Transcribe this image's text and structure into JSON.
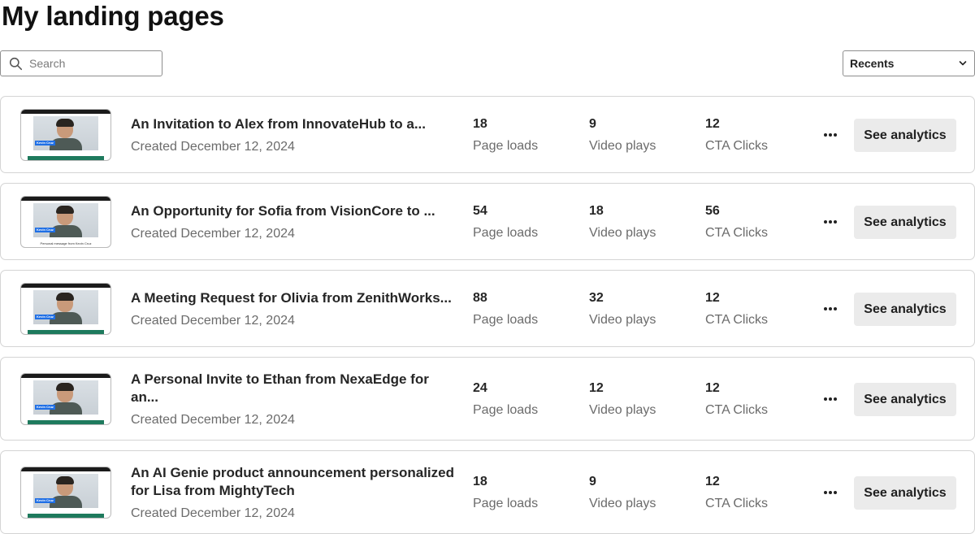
{
  "page": {
    "title": "My landing pages"
  },
  "search": {
    "placeholder": "Search"
  },
  "sort": {
    "selected": "Recents"
  },
  "thumbnail": {
    "person_label": "Kevin Cruz",
    "caption": "Personal message from Kevin Cruz"
  },
  "metric_labels": {
    "page_loads": "Page loads",
    "video_plays": "Video plays",
    "cta_clicks": "CTA Clicks"
  },
  "actions": {
    "see_analytics": "See analytics"
  },
  "landing_pages": [
    {
      "title": "An Invitation to Alex from InnovateHub to a...",
      "created": "Created December 12, 2024",
      "page_loads": "18",
      "video_plays": "9",
      "cta_clicks": "12"
    },
    {
      "title": "An Opportunity for Sofia from VisionCore to ...",
      "created": "Created December 12, 2024",
      "page_loads": "54",
      "video_plays": "18",
      "cta_clicks": "56"
    },
    {
      "title": "A Meeting Request for Olivia from ZenithWorks...",
      "created": "Created December 12, 2024",
      "page_loads": "88",
      "video_plays": "32",
      "cta_clicks": "12"
    },
    {
      "title": "A Personal Invite to Ethan from NexaEdge for an...",
      "created": "Created December 12, 2024",
      "page_loads": "24",
      "video_plays": "12",
      "cta_clicks": "12"
    },
    {
      "title": "An AI Genie product announcement personalized for Lisa from MightyTech",
      "created": "Created December 12, 2024",
      "page_loads": "18",
      "video_plays": "9",
      "cta_clicks": "12"
    }
  ],
  "colors": {
    "name_tag": "#1f6fe5",
    "thumb_bar": "#1e7a5d",
    "button_bg": "#ebebeb",
    "border": "#d4d4d4"
  },
  "icons": {
    "search": "search-icon",
    "dropdown": "chevron-down-icon",
    "more": "more-options-icon"
  }
}
